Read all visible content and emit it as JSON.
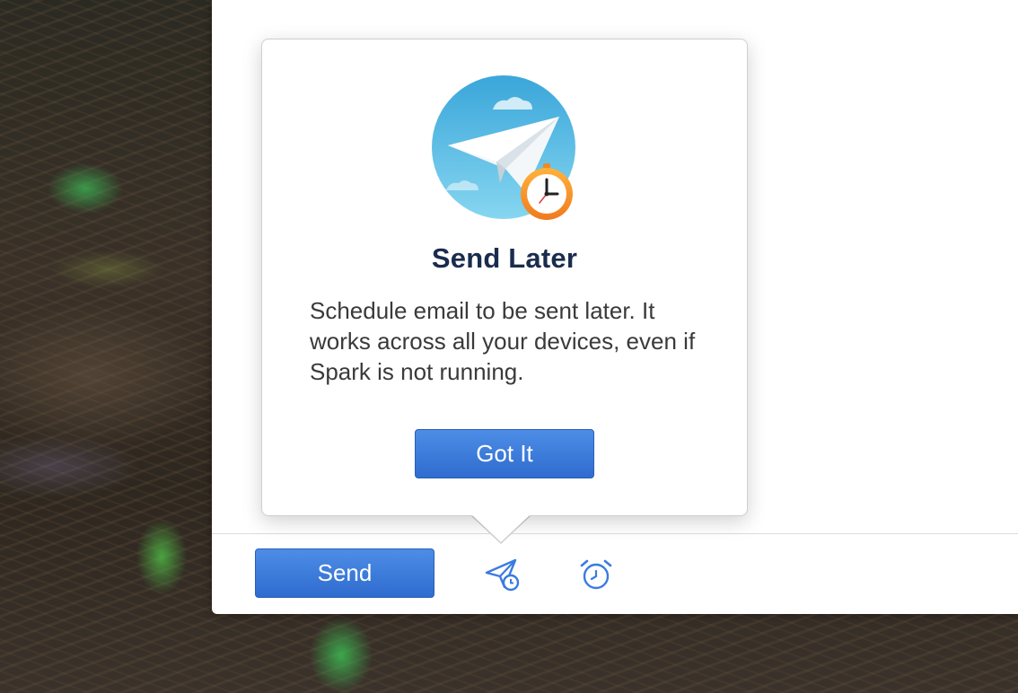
{
  "popover": {
    "title": "Send Later",
    "body": "Schedule email to be sent later. It works across all your devices, even if Spark is not running.",
    "button_label": "Got It",
    "illustration_icon": "paper-plane-with-clock-icon"
  },
  "toolbar": {
    "send_label": "Send",
    "send_later_icon": "send-later-icon",
    "snooze_icon": "alarm-clock-icon"
  },
  "colors": {
    "accent": "#3a78d8",
    "title": "#1a2c4e",
    "body_text": "#3a3a3a",
    "icon": "#3a7be0"
  }
}
